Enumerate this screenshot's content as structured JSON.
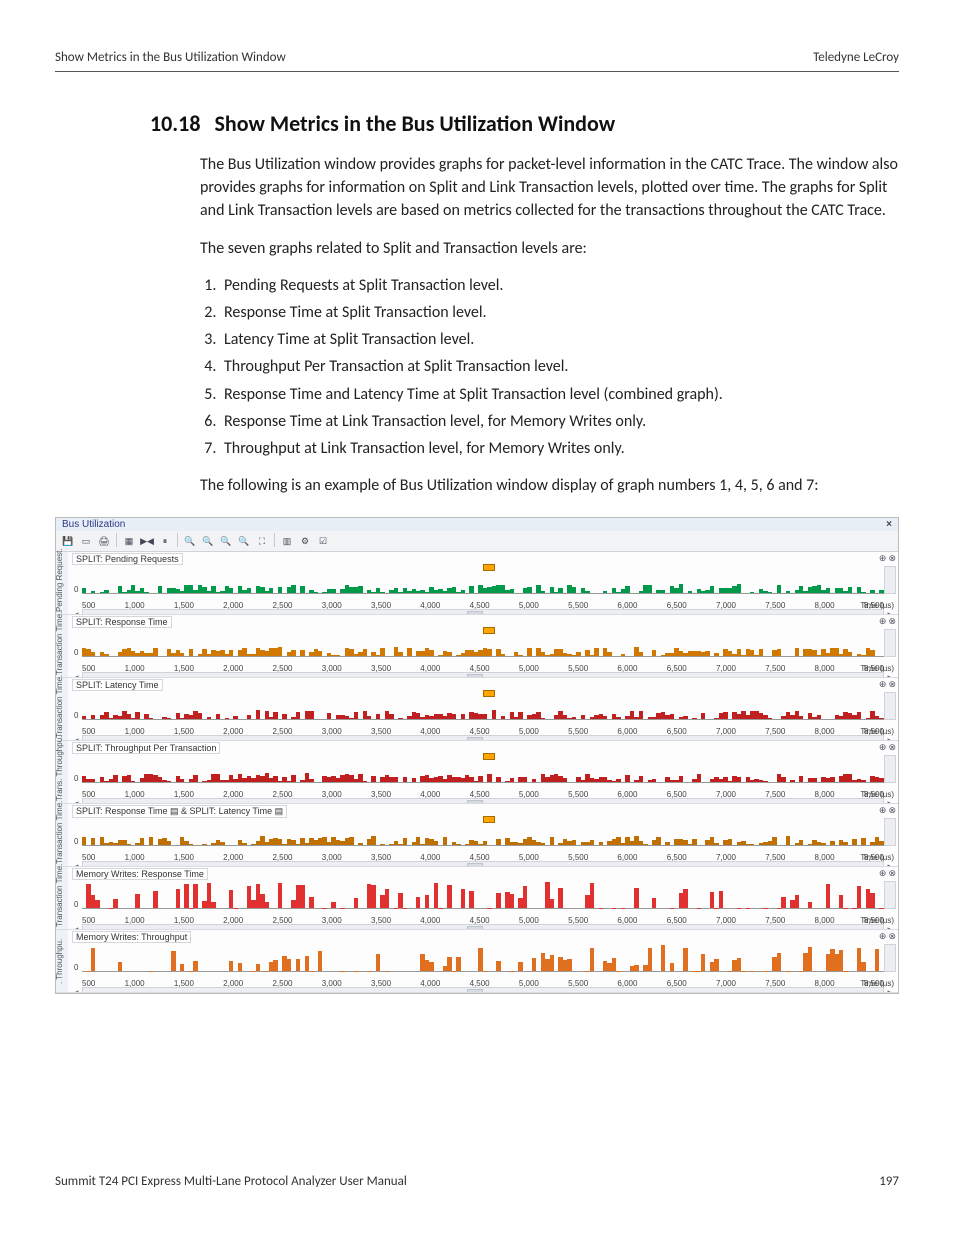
{
  "header": {
    "left": "Show Metrics in the Bus Utilization Window",
    "right": "Teledyne LeCroy"
  },
  "section": {
    "number": "10.18",
    "title": "Show Metrics in the Bus Utilization Window"
  },
  "paragraphs": {
    "p1": "The Bus Utilization window provides graphs for packet-level information in the CATC Trace. The window also provides graphs for information on Split and Link Transaction levels, plotted over time. The graphs for Split and Link Transaction levels are based on metrics collected for the transactions throughout the CATC Trace.",
    "p2": "The seven graphs related to Split and Transaction levels are:",
    "p3": "The following is an example of Bus Utilization window display of graph numbers 1, 4, 5, 6 and 7:"
  },
  "list": [
    "Pending Requests at Split Transaction level.",
    "Response Time at Split Transaction level.",
    "Latency Time at Split Transaction level.",
    "Throughput Per Transaction at Split Transaction level.",
    "Response Time and Latency Time at Split Transaction level (combined graph).",
    "Response Time at Link Transaction level, for Memory Writes only.",
    "Throughput at Link Transaction level, for Memory Writes only."
  ],
  "footer": {
    "left": "Summit T24 PCI Express Multi-Lane Protocol Analyzer User Manual",
    "right": "197"
  },
  "screenshot": {
    "window_title": "Bus Utilization",
    "close": "×",
    "toolbar_icons": [
      "save-icon",
      "open-icon",
      "print-icon",
      "grid-icon",
      "play-prev-icon",
      "pause-icon",
      "zoom-in-icon",
      "zoom-out-icon",
      "zoom-fit-icon",
      "zoom-region-icon",
      "expand-icon",
      "export-icon",
      "settings-icon",
      "check-icon"
    ],
    "xaxis": {
      "label": "Time (µs)",
      "ticks": [
        "500",
        "1,000",
        "1,500",
        "2,000",
        "2,500",
        "3,000",
        "3,500",
        "4,000",
        "4,500",
        "5,000",
        "5,500",
        "6,000",
        "6,500",
        "7,000",
        "7,500",
        "8,000",
        "8,500"
      ]
    },
    "panel_ctrl_icons": [
      "plus-icon",
      "gear-icon"
    ],
    "panels": [
      {
        "ylabel": "Pending Request.",
        "title": "SPLIT: Pending Requests",
        "color": "#009a4a",
        "marker": true
      },
      {
        "ylabel": "Transaction Time.",
        "title": "SPLIT: Response Time",
        "color": "#d07800",
        "marker": true
      },
      {
        "ylabel": "Transaction Time.",
        "title": "SPLIT: Latency Time",
        "color": "#c02020",
        "marker": true
      },
      {
        "ylabel": "Trans. Throughpu.",
        "title": "SPLIT: Throughput Per Transaction",
        "color": "#c02020",
        "marker": true
      },
      {
        "ylabel": "Transaction Time.",
        "title": "SPLIT: Response Time ▤ & SPLIT: Latency Time ▤",
        "color": "#c07000",
        "marker": true,
        "legends": true
      },
      {
        "ylabel": "Transaction Time.",
        "title": "Memory Writes: Response Time",
        "color": "#e03030",
        "marker": false
      },
      {
        "ylabel": ". Throughpu.",
        "title": "Memory Writes: Throughput",
        "color": "#e07020",
        "marker": false
      }
    ]
  },
  "chart_data": [
    {
      "type": "bar",
      "title": "SPLIT: Pending Requests",
      "xlabel": "Time (µs)",
      "ylabel": "Pending Requests",
      "xlim": [
        0,
        9000
      ],
      "note": "dense small bars across full range"
    },
    {
      "type": "bar",
      "title": "SPLIT: Response Time",
      "xlabel": "Time (µs)",
      "ylabel": "Transaction Time",
      "xlim": [
        0,
        9000
      ]
    },
    {
      "type": "bar",
      "title": "SPLIT: Latency Time",
      "xlabel": "Time (µs)",
      "ylabel": "Transaction Time",
      "xlim": [
        0,
        9000
      ]
    },
    {
      "type": "bar",
      "title": "SPLIT: Throughput Per Transaction",
      "xlabel": "Time (µs)",
      "ylabel": "Trans. Throughput",
      "xlim": [
        0,
        9000
      ]
    },
    {
      "type": "bar",
      "title": "SPLIT: Response Time & SPLIT: Latency Time",
      "series": [
        {
          "name": "Response Time"
        },
        {
          "name": "Latency Time"
        }
      ],
      "xlabel": "Time (µs)",
      "ylabel": "Transaction Time",
      "xlim": [
        0,
        9000
      ]
    },
    {
      "type": "bar",
      "title": "Memory Writes: Response Time",
      "xlabel": "Time (µs)",
      "ylabel": "Transaction Time",
      "xlim": [
        0,
        9000
      ]
    },
    {
      "type": "bar",
      "title": "Memory Writes: Throughput",
      "xlabel": "Time (µs)",
      "ylabel": "Throughput",
      "xlim": [
        0,
        9000
      ]
    }
  ]
}
